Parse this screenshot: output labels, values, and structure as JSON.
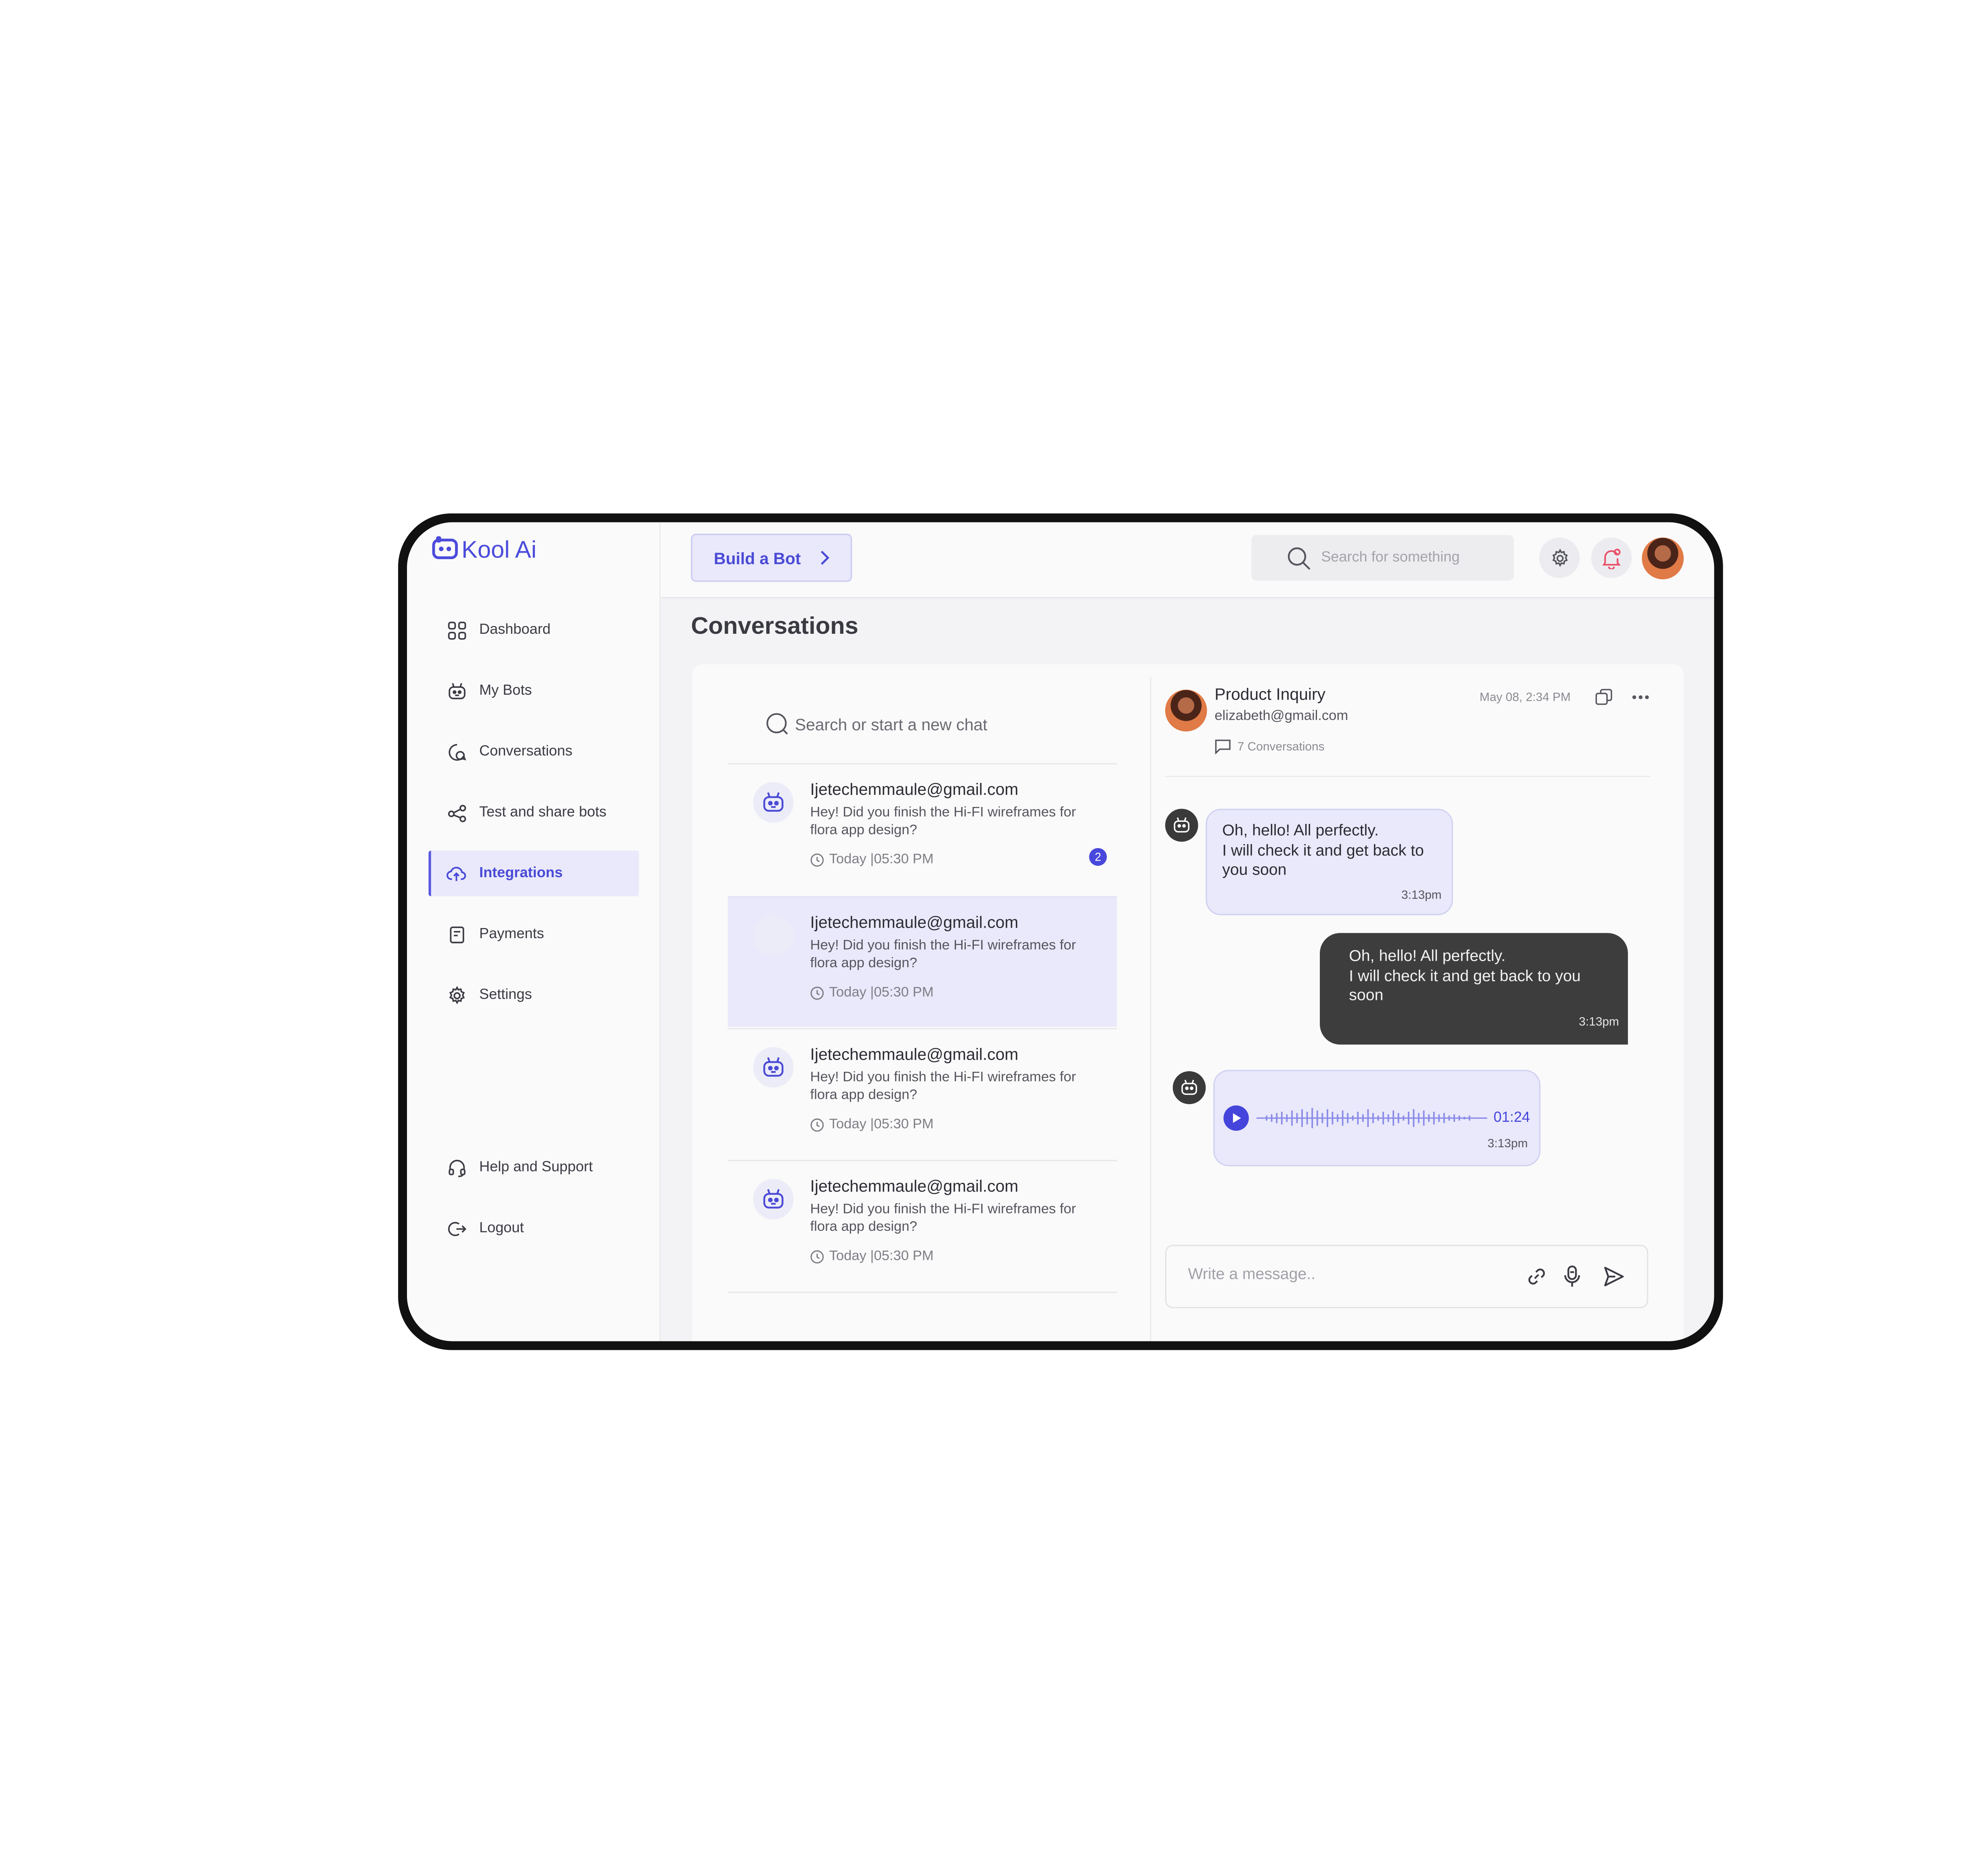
{
  "app": {
    "name": "Kool Ai"
  },
  "colors": {
    "accent": "#4a4ad6",
    "accent_bg": "#e9e9fb",
    "dark_bubble": "#3d3d3d",
    "badge": "#4848dd"
  },
  "sidebar": {
    "items": [
      {
        "label": "Dashboard",
        "icon": "grid-icon"
      },
      {
        "label": "My Bots",
        "icon": "bot-icon"
      },
      {
        "label": "Conversations",
        "icon": "chat-icon"
      },
      {
        "label": "Test and share bots",
        "icon": "share-icon"
      },
      {
        "label": "Integrations",
        "icon": "cloud-icon",
        "active": true
      },
      {
        "label": "Payments",
        "icon": "receipt-icon"
      },
      {
        "label": "Settings",
        "icon": "gear-icon"
      }
    ],
    "bottom_items": [
      {
        "label": "Help and Support",
        "icon": "headset-icon"
      },
      {
        "label": "Logout",
        "icon": "logout-icon"
      }
    ]
  },
  "header": {
    "build_button": "Build a Bot",
    "search_placeholder": "Search for something"
  },
  "page": {
    "title": "Conversations"
  },
  "chat_list": {
    "search_placeholder": "Search or start a new chat",
    "items": [
      {
        "email": "Ijetechemmaule@gmail.com",
        "message": "Hey! Did you finish the Hi-FI wireframes for flora app design?",
        "time": "Today |05:30 PM",
        "unread": "2",
        "avatar": "bot-icon"
      },
      {
        "email": "Ijetechemmaule@gmail.com",
        "message": "Hey! Did you finish the Hi-FI wireframes for flora app design?",
        "time": "Today |05:30 PM",
        "avatar": "user-photo",
        "selected": true
      },
      {
        "email": "Ijetechemmaule@gmail.com",
        "message": "Hey! Did you finish the Hi-FI wireframes for flora app design?",
        "time": "Today |05:30 PM",
        "avatar": "bot-icon"
      },
      {
        "email": "Ijetechemmaule@gmail.com",
        "message": "Hey! Did you finish the Hi-FI wireframes for flora app design?",
        "time": "Today |05:30 PM",
        "avatar": "bot-icon"
      }
    ]
  },
  "chat": {
    "title": "Product Inquiry",
    "email": "elizabeth@gmail.com",
    "conversations_count": "7 Conversations",
    "date": "May 08, 2:34 PM",
    "messages": [
      {
        "from": "bot",
        "text": "Oh, hello! All perfectly.\nI will check it and get back to you soon",
        "time": "3:13pm"
      },
      {
        "from": "user",
        "text": "Oh, hello! All perfectly.\nI will check it and get back to you soon",
        "time": "3:13pm"
      },
      {
        "from": "bot",
        "type": "audio",
        "duration": "01:24",
        "time": "3:13pm"
      }
    ],
    "composer_placeholder": "Write a message.."
  }
}
